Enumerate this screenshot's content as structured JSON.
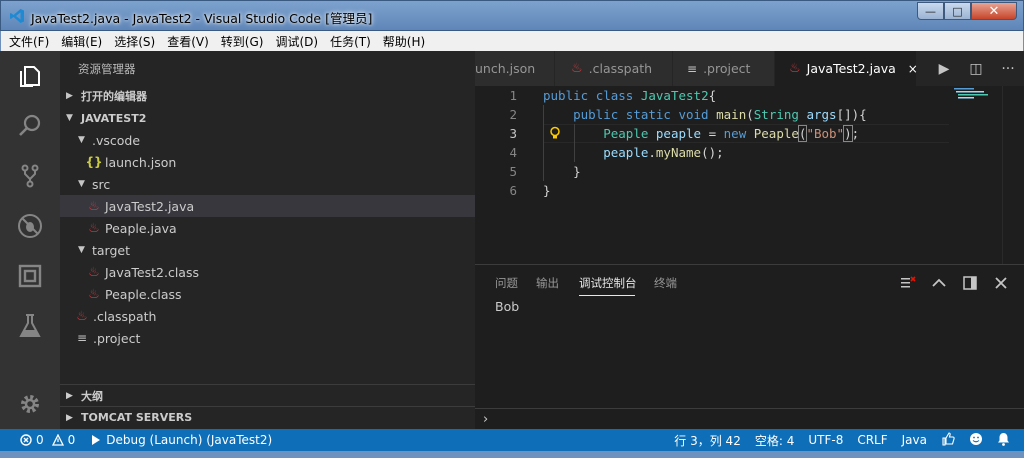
{
  "window": {
    "title": "JavaTest2.java - JavaTest2 - Visual Studio Code [管理员]",
    "minimize": "—",
    "maximize": "□",
    "close": "✕"
  },
  "menu": [
    "文件(F)",
    "编辑(E)",
    "选择(S)",
    "查看(V)",
    "转到(G)",
    "调试(D)",
    "任务(T)",
    "帮助(H)"
  ],
  "activity_icons": [
    "explorer-icon",
    "search-icon",
    "source-control-icon",
    "debug-icon",
    "extensions-icon",
    "test-icon",
    "gear-icon"
  ],
  "sidebar": {
    "title": "资源管理器",
    "open_editors": "打开的编辑器",
    "project": "JAVATEST2",
    "tree": [
      {
        "label": ".vscode",
        "type": "folder",
        "depth": 1
      },
      {
        "label": "launch.json",
        "type": "json",
        "depth": 2
      },
      {
        "label": "src",
        "type": "folder",
        "depth": 1
      },
      {
        "label": "JavaTest2.java",
        "type": "java",
        "depth": 2,
        "selected": true
      },
      {
        "label": "Peaple.java",
        "type": "java",
        "depth": 2
      },
      {
        "label": "target",
        "type": "folder",
        "depth": 1
      },
      {
        "label": "JavaTest2.class",
        "type": "java",
        "depth": 2
      },
      {
        "label": "Peaple.class",
        "type": "java",
        "depth": 2
      },
      {
        "label": ".classpath",
        "type": "java",
        "depth": 1
      },
      {
        "label": ".project",
        "type": "lines",
        "depth": 1
      }
    ],
    "outline": "大纲",
    "tomcat": "TOMCAT SERVERS"
  },
  "tabs": [
    {
      "label": "launch.json",
      "visible_label": "unch.json",
      "icon": "json"
    },
    {
      "label": ".classpath",
      "icon": "java"
    },
    {
      "label": ".project",
      "icon": "lines"
    },
    {
      "label": "JavaTest2.java",
      "icon": "java",
      "active": true,
      "close": "×"
    }
  ],
  "editor_actions": [
    "▶",
    "◫",
    "···"
  ],
  "code_lines": [
    "1",
    "2",
    "3",
    "4",
    "5",
    "6"
  ],
  "current_line": 3,
  "panel": {
    "tabs": [
      "问题",
      "输出",
      "调试控制台",
      "终端"
    ],
    "active_tab": "调试控制台",
    "output": "Bob",
    "prompt": "›",
    "actions": [
      "clear-console-icon",
      "chevron-up-icon",
      "maximize-panel-icon",
      "close-icon"
    ]
  },
  "status": {
    "errors": "0",
    "warnings": "0",
    "debug": "Debug (Launch) (JavaTest2)",
    "position": "行 3，列 42",
    "spaces": "空格: 4",
    "encoding": "UTF-8",
    "eol": "CRLF",
    "language": "Java"
  },
  "colors": {
    "statusbar": "#0e6fb8",
    "activitybar": "#333333",
    "sidebar": "#252526",
    "editor": "#1e1e1e"
  }
}
